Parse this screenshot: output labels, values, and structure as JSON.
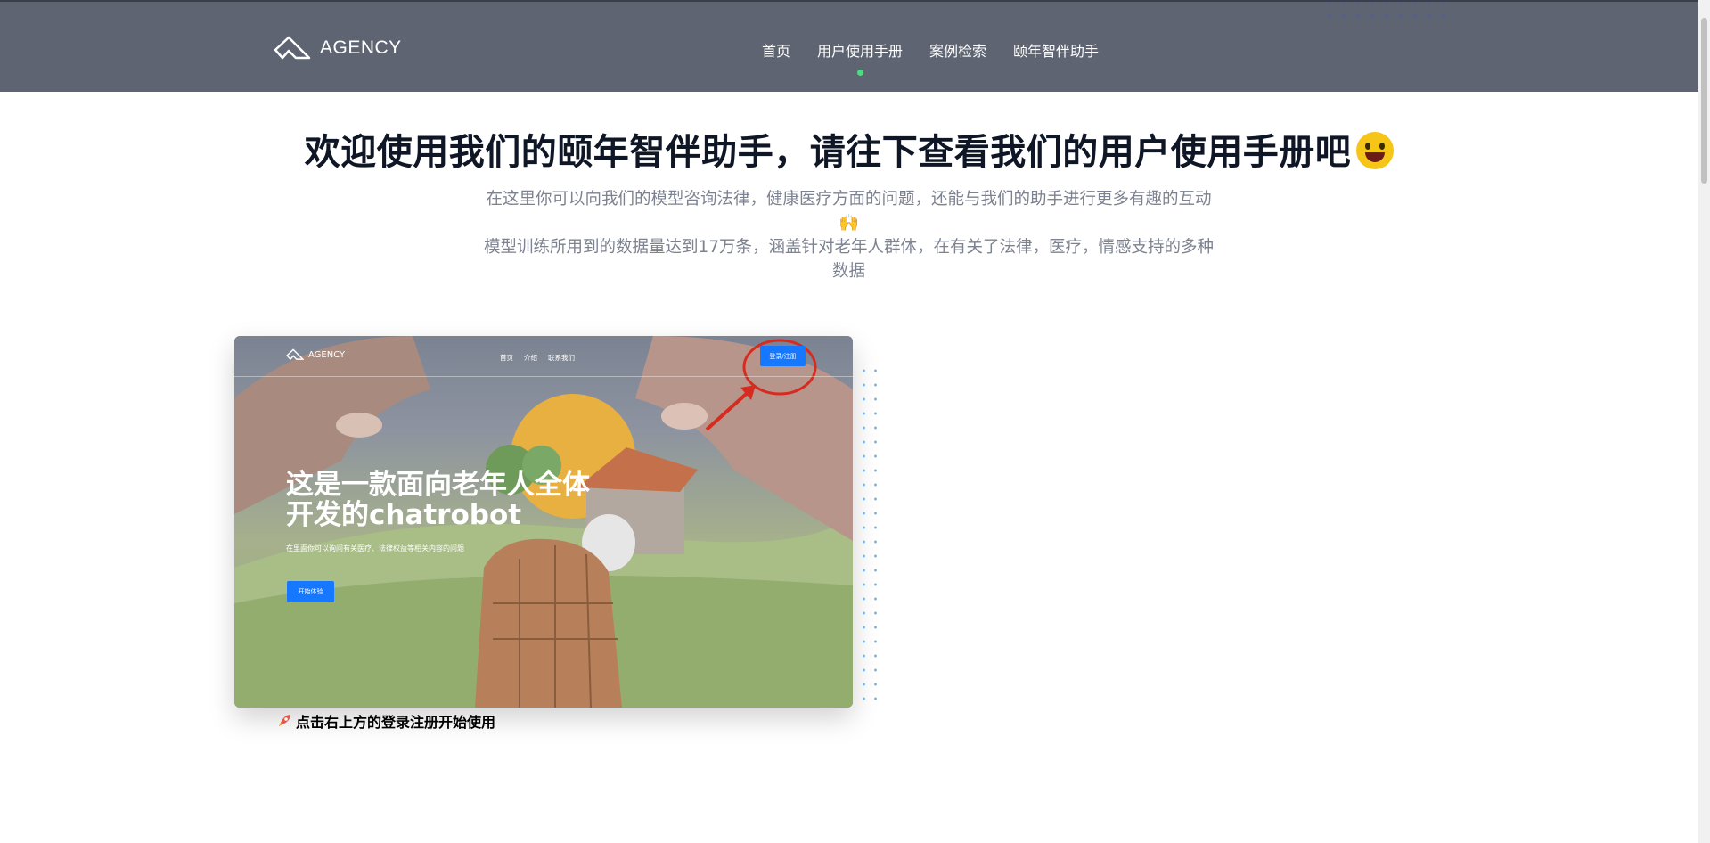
{
  "header": {
    "brand": "AGENCY",
    "nav": [
      {
        "label": "首页",
        "active": false
      },
      {
        "label": "用户使用手册",
        "active": true
      },
      {
        "label": "案例检索",
        "active": false
      },
      {
        "label": "颐年智伴助手",
        "active": false
      }
    ]
  },
  "hero": {
    "title": "欢迎使用我们的颐年智伴助手，请往下查看我们的用户使用手册吧",
    "title_emoji": "grinning-face-icon",
    "subtitle_line1": "在这里你可以向我们的模型咨询法律，健康医疗方面的问题，还能与我们的助手进行更多有趣的互动🙌",
    "subtitle_line2": "模型训练所用到的数据量达到17万条，涵盖针对老年人群体，在有关了法律，医疗，情感支持的多种数据"
  },
  "preview": {
    "brand": "AGENCY",
    "nav": [
      "首页",
      "介绍",
      "联系我们"
    ],
    "login_label": "登录/注册",
    "heading": "这是一款面向老年人全体开发的chatrobot",
    "description": "在里面你可以询问有关医疗、法律权益等相关内容的问题",
    "cta_label": "开始体验"
  },
  "caption": {
    "icon": "rocket-icon",
    "text": "点击右上方的登录注册开始使用"
  },
  "colors": {
    "header_bg": "#5e6472",
    "active_dot": "#4ade80",
    "title": "#0f1626",
    "subtitle": "#7d8290",
    "accent_blue": "#1677ff"
  }
}
